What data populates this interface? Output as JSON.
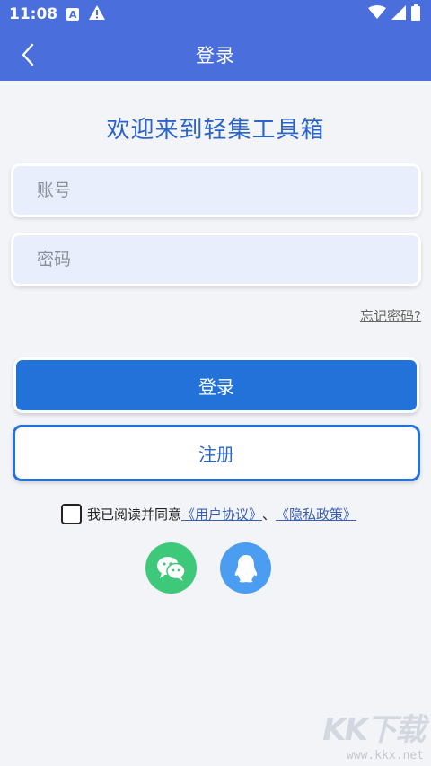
{
  "status_bar": {
    "time": "11:08",
    "left_icons": [
      "font-a-icon",
      "warning-icon"
    ],
    "right_icons": [
      "wifi-icon",
      "signal-icon",
      "battery-icon"
    ]
  },
  "header": {
    "title": "登录",
    "back_icon": "chevron-left-icon",
    "bg_color": "#4a6fdc"
  },
  "welcome_text": "欢迎来到轻集工具箱",
  "form": {
    "account_placeholder": "账号",
    "password_placeholder": "密码",
    "forgot_label": "忘记密码?"
  },
  "buttons": {
    "login_label": "登录",
    "register_label": "注册",
    "accent": "#2372d9"
  },
  "agreement": {
    "checked": false,
    "prefix": "我已阅读并同意",
    "user_agreement": "《用户协议》",
    "separator": "、",
    "privacy_policy": "《隐私政策》"
  },
  "social_login": [
    {
      "name": "wechat-icon",
      "color": "#3ec97a"
    },
    {
      "name": "qq-icon",
      "color": "#4a9df0"
    }
  ],
  "watermark": {
    "logo_text": "KK下载",
    "url": "www.kkx.net"
  }
}
